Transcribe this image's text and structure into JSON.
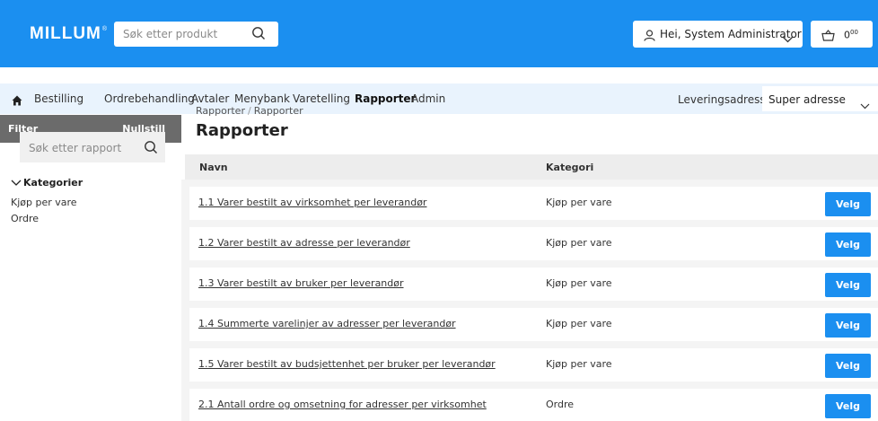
{
  "header": {
    "logo": "MILLUM",
    "logo_mark": "®",
    "search_placeholder": "Søk etter produkt",
    "user_label": "Hei, System Administrator",
    "cart_amount": "0",
    "cart_decimals": "00"
  },
  "nav": {
    "items": [
      "Bestilling",
      "Ordrebehandling",
      "Avtaler",
      "Menybank",
      "Varetelling",
      "Rapporter",
      "Admin"
    ],
    "active": "Rapporter",
    "delivery_label": "Leveringsadresse",
    "delivery_value": "Super adresse"
  },
  "filter": {
    "title": "Filter",
    "reset": "Nullstill",
    "search_placeholder": "Søk etter rapport",
    "categories_title": "Kategorier",
    "categories": [
      "Kjøp per vare",
      "Ordre"
    ]
  },
  "main": {
    "breadcrumb": [
      "Rapporter",
      "Rapporter"
    ],
    "title": "Rapporter",
    "columns": [
      "Navn",
      "Kategori"
    ],
    "rows": [
      {
        "name": "1.1 Varer bestilt av virksomhet per leverandør",
        "category": "Kjøp per vare",
        "action": "Velg"
      },
      {
        "name": "1.2 Varer bestilt av adresse per leverandør",
        "category": "Kjøp per vare",
        "action": "Velg"
      },
      {
        "name": "1.3 Varer bestilt av bruker per leverandør",
        "category": "Kjøp per vare",
        "action": "Velg"
      },
      {
        "name": "1.4 Summerte varelinjer av adresser per leverandør",
        "category": "Kjøp per vare",
        "action": "Velg"
      },
      {
        "name": "1.5 Varer bestilt av budsjettenhet per bruker per leverandør",
        "category": "Kjøp per vare",
        "action": "Velg"
      },
      {
        "name": "2.1 Antall ordre og omsetning for adresser per virksomhet",
        "category": "Ordre",
        "action": "Velg"
      }
    ]
  },
  "colors": {
    "brand": "#1b8ff0",
    "nav_bg": "#e9f3fd",
    "filter_header": "#6b6b6b"
  }
}
